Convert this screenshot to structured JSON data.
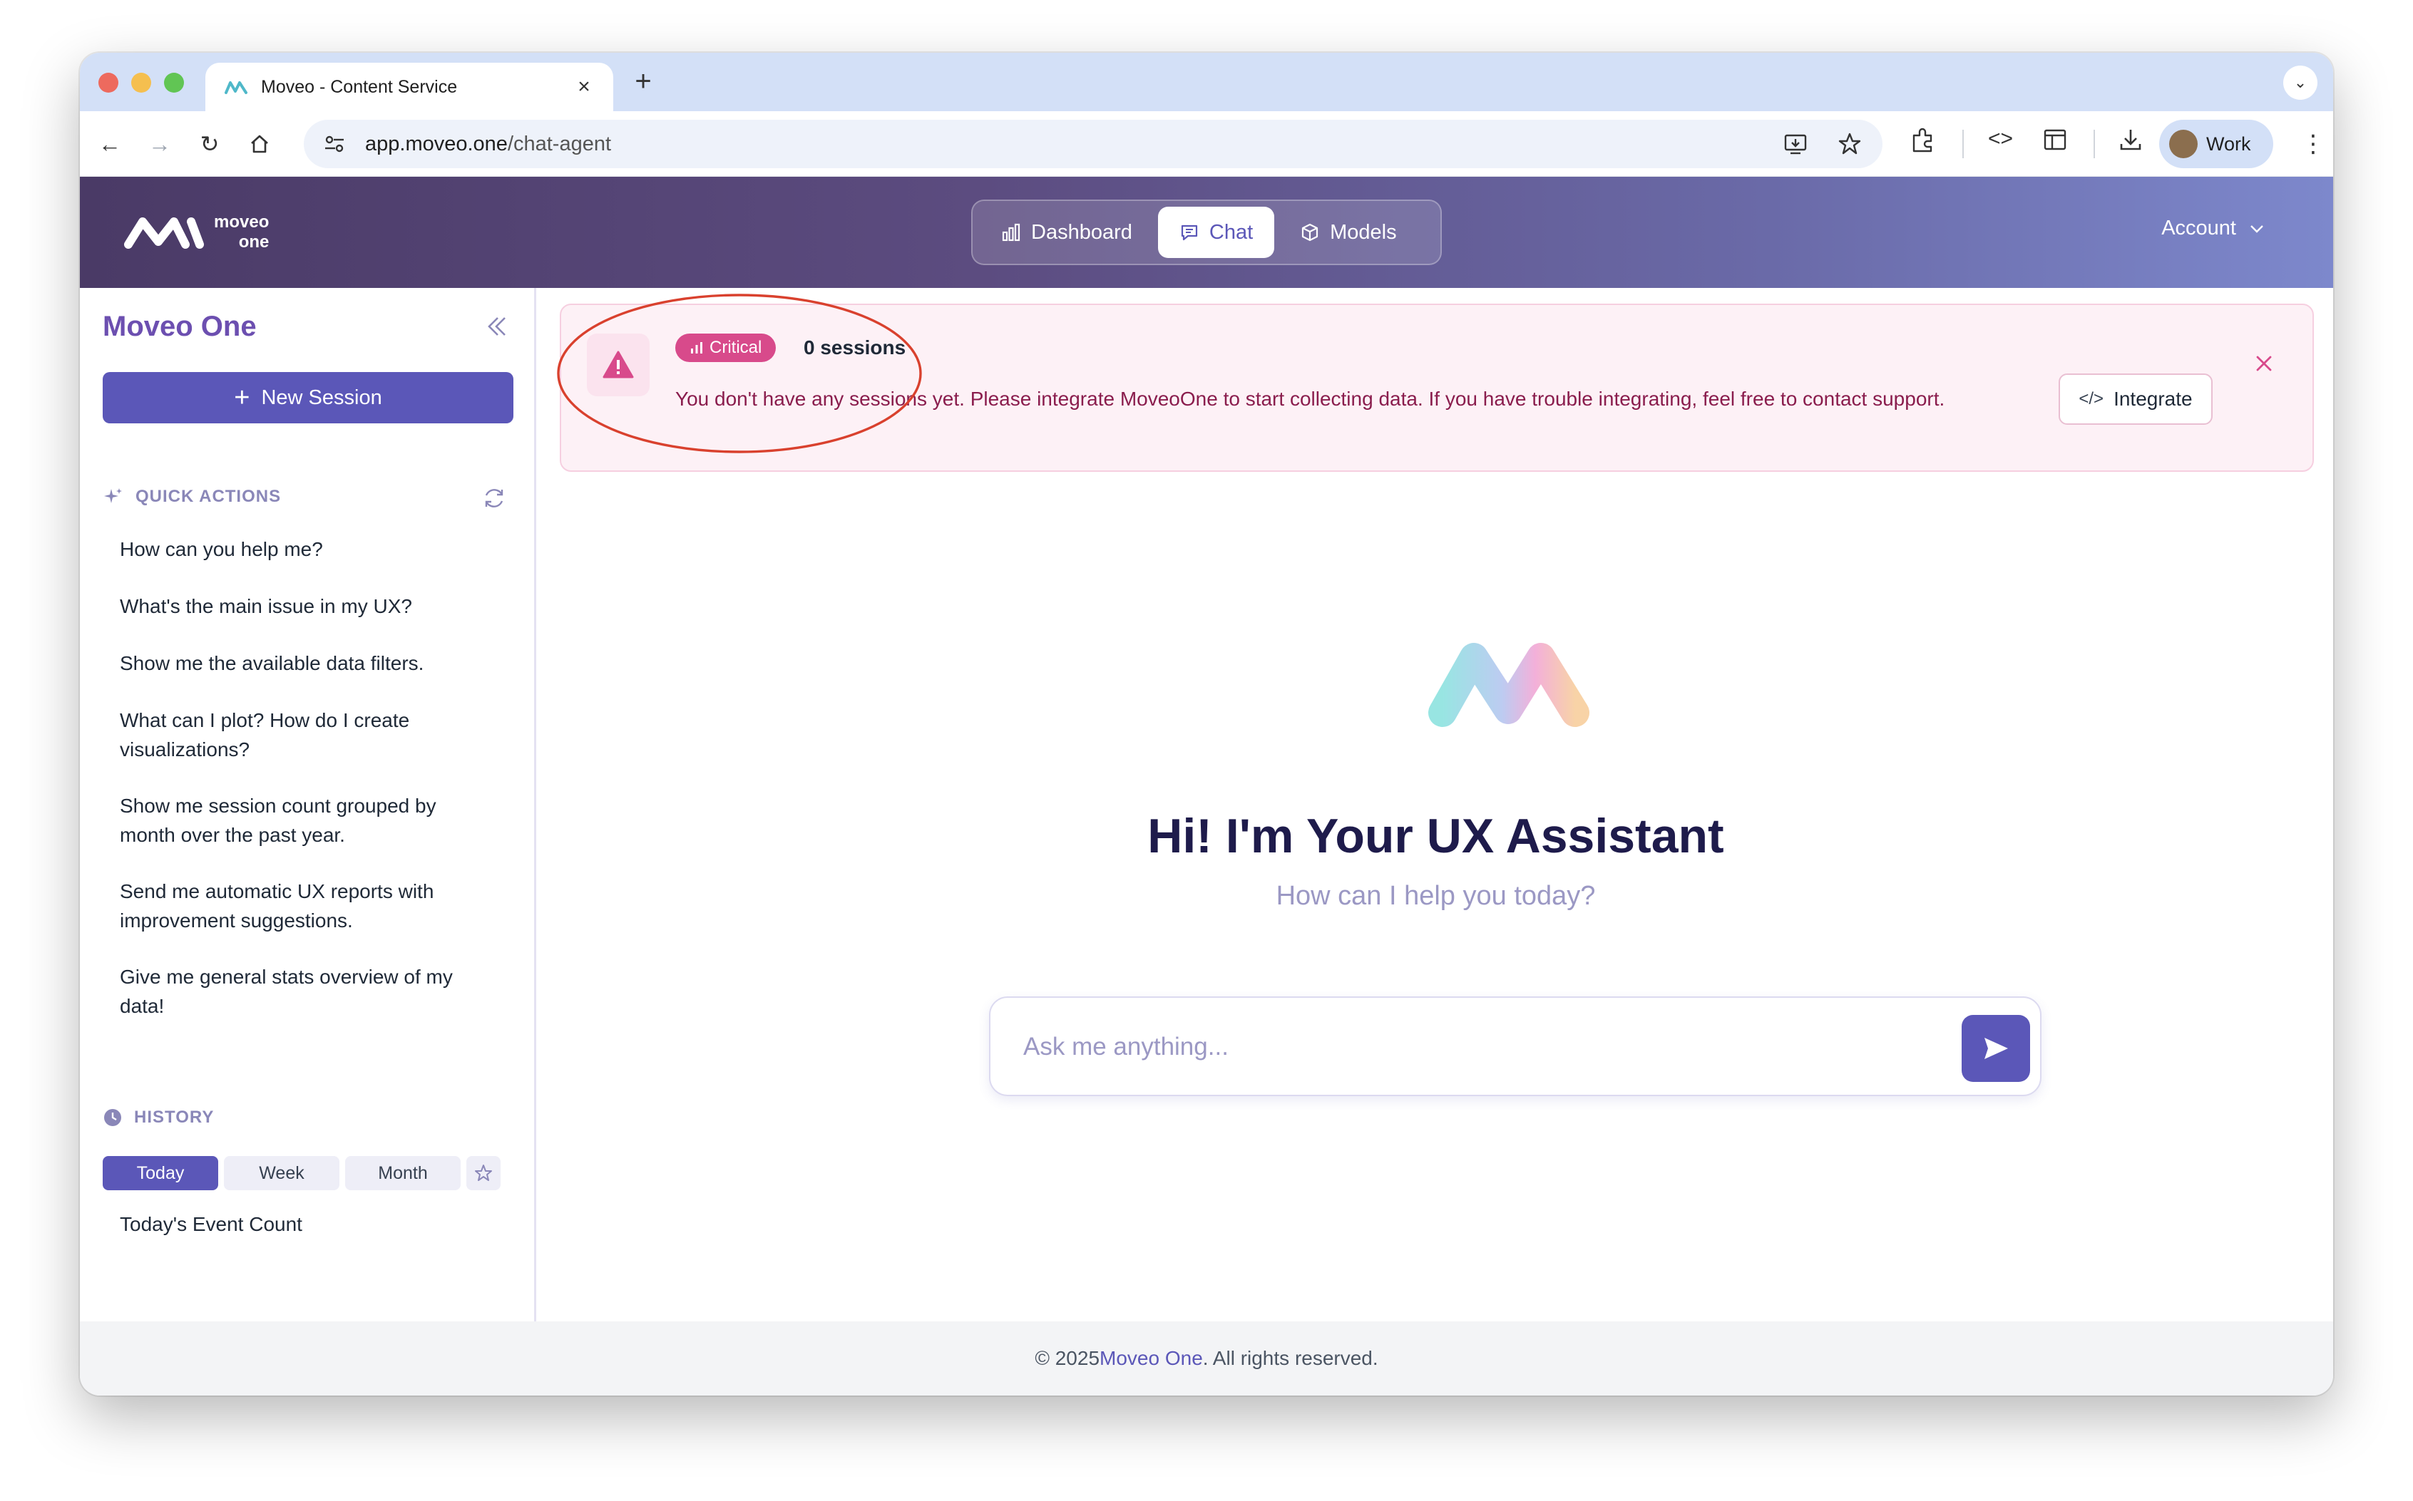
{
  "browser": {
    "tab_title": "Moveo - Content Service",
    "url_host": "app.moveo.one",
    "url_path": "/chat-agent",
    "profile_label": "Work"
  },
  "header": {
    "logo_line1": "moveo",
    "logo_line2": "one",
    "nav": [
      {
        "label": "Dashboard",
        "icon": "bar-chart-icon"
      },
      {
        "label": "Chat",
        "icon": "chat-bubble-icon",
        "active": true
      },
      {
        "label": "Models",
        "icon": "cube-icon"
      }
    ],
    "account_label": "Account"
  },
  "sidebar": {
    "title": "Moveo One",
    "new_session_label": "New Session",
    "quick_actions_title": "QUICK ACTIONS",
    "quick_actions": [
      "How can you help me?",
      "What's the main issue in my UX?",
      "Show me the available data filters.",
      "What can I plot? How do I create visualizations?",
      "Show me session count grouped by month over the past year.",
      "Send me automatic UX reports with improvement suggestions.",
      "Give me general stats overview of my data!"
    ],
    "history_title": "HISTORY",
    "history_tabs": [
      "Today",
      "Week",
      "Month"
    ],
    "history_active_tab": "Today",
    "history_items": [
      "Today's Event Count"
    ]
  },
  "alert": {
    "badge": "Critical",
    "sessions": "0 sessions",
    "message": "You don't have any sessions yet. Please integrate MoveoOne to start collecting data. If you have trouble integrating, feel free to contact support.",
    "integrate_label": "Integrate"
  },
  "hero": {
    "title": "Hi! I'm Your UX Assistant",
    "subtitle": "How can I help you today?",
    "input_placeholder": "Ask me anything..."
  },
  "footer": {
    "prefix": "© 2025 ",
    "brand": "Moveo One",
    "suffix": ". All rights reserved."
  },
  "colors": {
    "accent": "#5b57b8",
    "critical": "#d84a8b",
    "annotation": "#d9412e",
    "header_start": "#4a3a66",
    "header_end": "#7d88cc"
  }
}
